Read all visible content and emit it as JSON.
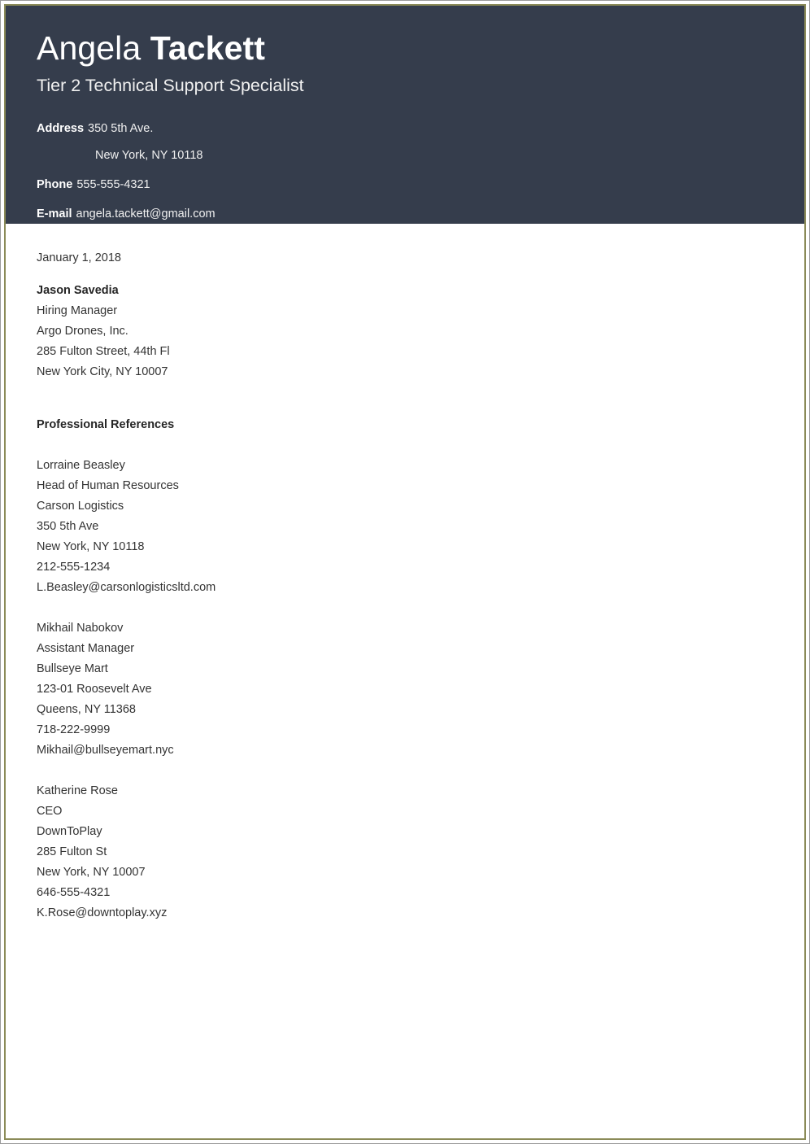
{
  "colors": {
    "header_background": "#353d4c",
    "page_border": "#8b8b58",
    "outer_border": "#9a9a9a",
    "header_text": "#ffffff",
    "body_text": "#333333"
  },
  "header": {
    "name_first": "Angela ",
    "name_last": "Tackett",
    "job_title": "Tier 2 Technical Support Specialist",
    "contacts": [
      {
        "label": "Address",
        "value": "350 5th Ave.",
        "subline": "New York, NY 10118"
      },
      {
        "label": "Phone",
        "value": "555-555-4321"
      },
      {
        "label": "E-mail",
        "value": "angela.tackett@gmail.com"
      }
    ]
  },
  "body": {
    "date": "January 1, 2018",
    "recipient": {
      "name": "Jason Savedia",
      "lines": [
        "Hiring Manager",
        "Argo Drones, Inc.",
        "285 Fulton Street, 44th Fl",
        "New York City, NY 10007"
      ]
    },
    "section_heading": "Professional References",
    "references": [
      {
        "name": "Lorraine Beasley",
        "title": "Head of Human Resources",
        "company": "Carson Logistics",
        "street": "350 5th Ave",
        "city": "New York, NY 10118",
        "phone": "212-555-1234",
        "email": "L.Beasley@carsonlogisticsltd.com"
      },
      {
        "name": "Mikhail Nabokov",
        "title": "Assistant Manager",
        "company": "Bullseye Mart",
        "street": "123-01 Roosevelt Ave",
        "city": "Queens, NY 11368",
        "phone": "718-222-9999",
        "email": "Mikhail@bullseyemart.nyc"
      },
      {
        "name": "Katherine Rose",
        "title": "CEO",
        "company": "DownToPlay",
        "street": "285 Fulton St",
        "city": "New York, NY 10007",
        "phone": "646-555-4321",
        "email": "K.Rose@downtoplay.xyz"
      }
    ]
  }
}
